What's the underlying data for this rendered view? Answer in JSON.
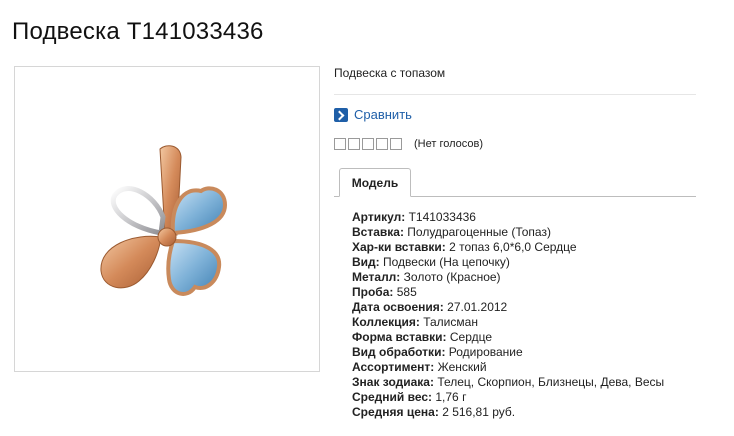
{
  "page": {
    "title": "Подвеска T141033436"
  },
  "product": {
    "subtitle": "Подвеска с топазом",
    "compare_label": "Сравнить",
    "rating": {
      "stars_total": 5,
      "stars_filled": 0,
      "votes_text": "(Нет голосов)"
    }
  },
  "tabs": [
    {
      "label": "Модель",
      "active": true
    }
  ],
  "specs": [
    {
      "key": "Артикул:",
      "value": "T141033436"
    },
    {
      "key": "Вставка:",
      "value": "Полудрагоценные (Топаз)"
    },
    {
      "key": "Хар-ки вставки:",
      "value": "2 топаз 6,0*6,0 Сердце"
    },
    {
      "key": "Вид:",
      "value": "Подвески (На цепочку)"
    },
    {
      "key": "Металл:",
      "value": "Золото (Красное)"
    },
    {
      "key": "Проба:",
      "value": "585"
    },
    {
      "key": "Дата освоения:",
      "value": "27.01.2012"
    },
    {
      "key": "Коллекция:",
      "value": "Талисман"
    },
    {
      "key": "Форма вставки:",
      "value": "Сердце"
    },
    {
      "key": "Вид обработки:",
      "value": "Родирование"
    },
    {
      "key": "Ассортимент:",
      "value": "Женский"
    },
    {
      "key": "Знак зодиака:",
      "value": "Телец, Скорпион, Близнецы, Дева, Весы"
    },
    {
      "key": "Средний вес:",
      "value": "1,76 г"
    },
    {
      "key": "Средняя цена:",
      "value": "2 516,81 руб."
    }
  ],
  "colors": {
    "link": "#1f5fa8",
    "gold": "#d48a5a",
    "topaz": "#7fb2d8",
    "silver": "#c9c9cc"
  },
  "icons": {
    "compare": "chevron-right-icon",
    "star": "star-outline-icon"
  }
}
